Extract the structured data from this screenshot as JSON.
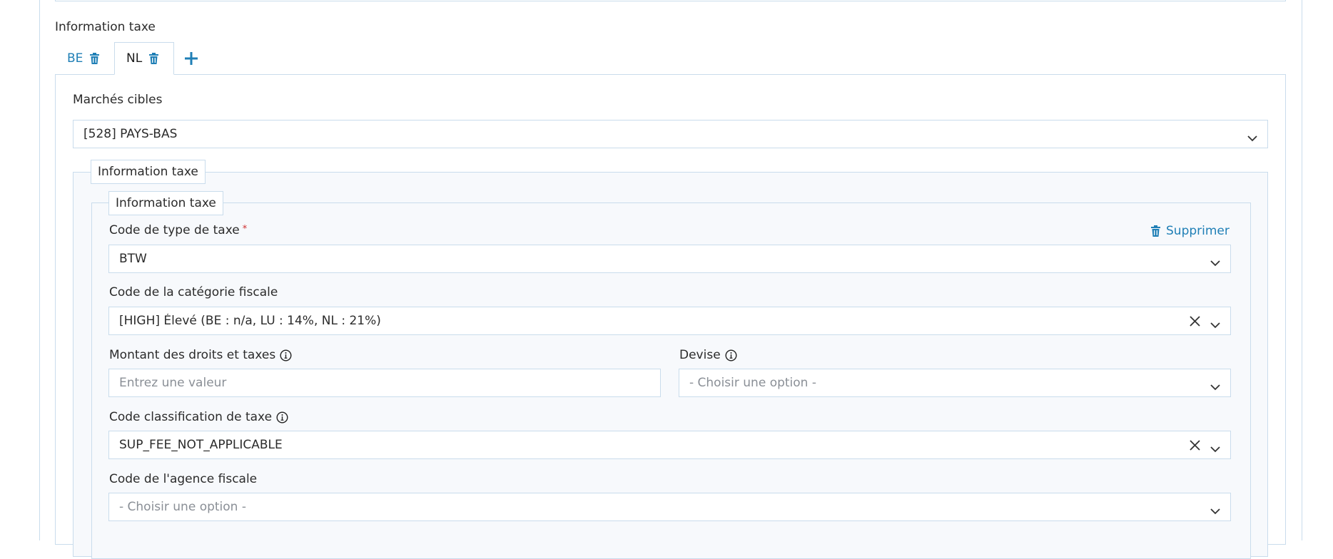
{
  "section": {
    "title": "Information taxe"
  },
  "tabs": [
    {
      "label": "BE",
      "active": false
    },
    {
      "label": "NL",
      "active": true
    }
  ],
  "panel": {
    "markets": {
      "label": "Marchés cibles",
      "value": "[528] PAYS-BAS"
    },
    "fieldset_outer": {
      "legend": "Information taxe"
    },
    "fieldset_inner": {
      "legend": "Information taxe",
      "delete_label": "Supprimer",
      "tax_type": {
        "label": "Code de type de taxe",
        "required_mark": "*",
        "value": "BTW"
      },
      "tax_category": {
        "label": "Code de la catégorie fiscale",
        "value": "[HIGH] Élevé (BE : n/a, LU : 14%, NL : 21%)"
      },
      "amount": {
        "label": "Montant des droits et taxes",
        "placeholder": "Entrez une valeur"
      },
      "currency": {
        "label": "Devise",
        "placeholder": "- Choisir une option -"
      },
      "tax_classification": {
        "label": "Code classification de taxe",
        "value": "SUP_FEE_NOT_APPLICABLE"
      },
      "tax_agency": {
        "label": "Code de l'agence fiscale",
        "placeholder": "- Choisir une option -"
      }
    }
  },
  "colors": {
    "accent": "#1f7fb6",
    "border": "#c9dcec",
    "required": "#d03030",
    "fieldset_bg": "#f7f9fc"
  },
  "icons": {
    "trash": "trash-icon",
    "add": "plus-icon",
    "chevron": "chevron-down-icon",
    "clear": "clear-x-icon",
    "info": "info-icon"
  }
}
